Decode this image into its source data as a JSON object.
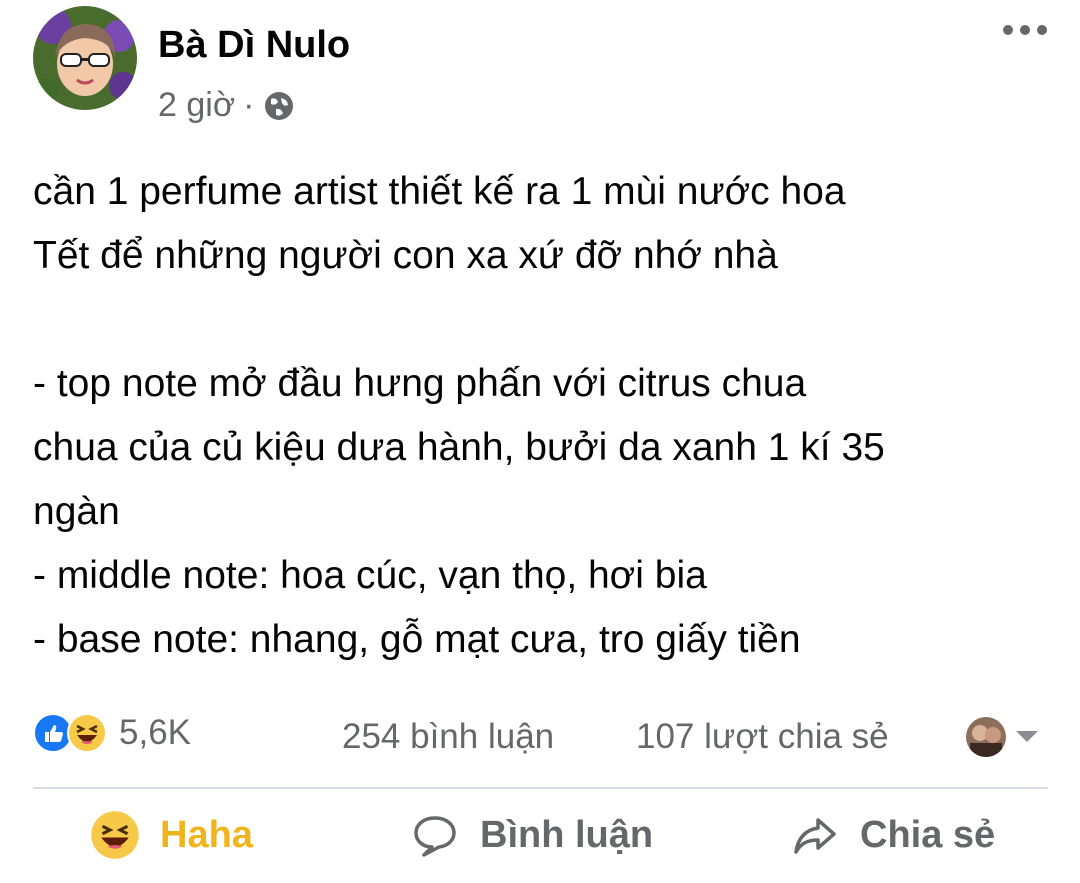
{
  "post": {
    "author": "Bà Dì Nulo",
    "time": "2 giờ",
    "separator": "·",
    "privacy_icon": "globe-icon",
    "text": "cần 1 perfume artist thiết kế ra 1 mùi nước hoa\nTết để những người con xa xứ đỡ nhớ nhà\n\n- top note mở đầu hưng phấn với citrus chua\nchua của củ kiệu dưa hành, bưởi da xanh 1 kí 35\nngàn\n- middle note: hoa cúc, vạn thọ, hơi bia\n- base note: nhang, gỗ mạt cưa, tro giấy tiền"
  },
  "stats": {
    "reactions_count": "5,6K",
    "comments": "254 bình luận",
    "shares": "107 lượt chia sẻ"
  },
  "actions": {
    "haha": "Haha",
    "comment": "Bình luận",
    "share": "Chia sẻ"
  },
  "colors": {
    "haha_active": "#f0b51c",
    "secondary_text": "#65676b",
    "like_blue": "#1877f2"
  }
}
